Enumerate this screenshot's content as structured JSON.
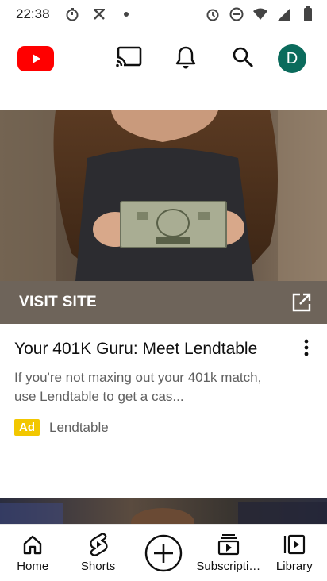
{
  "status_bar": {
    "time": "22:38"
  },
  "header": {
    "logo": "youtube-logo",
    "cast_icon": "cast-icon",
    "notifications_icon": "bell-icon",
    "search_icon": "search-icon",
    "avatar_letter": "D"
  },
  "ad": {
    "visit_label": "VISIT SITE",
    "title": "Your 401K Guru: Meet Lendtable",
    "description": "If you're not maxing out your 401k match, use Lendtable to get a cas...",
    "badge": "Ad",
    "advertiser": "Lendtable"
  },
  "bottom_nav": {
    "items": [
      {
        "label": "Home",
        "icon": "home-icon"
      },
      {
        "label": "Shorts",
        "icon": "shorts-icon"
      },
      {
        "label": "",
        "icon": "create-icon"
      },
      {
        "label": "Subscriptions",
        "icon": "subscriptions-icon"
      },
      {
        "label": "Library",
        "icon": "library-icon"
      }
    ]
  },
  "colors": {
    "brand_red": "#ff0000",
    "avatar_bg": "#0b6b5c",
    "visit_bar": "#6e645a",
    "ad_badge": "#f2c700"
  }
}
